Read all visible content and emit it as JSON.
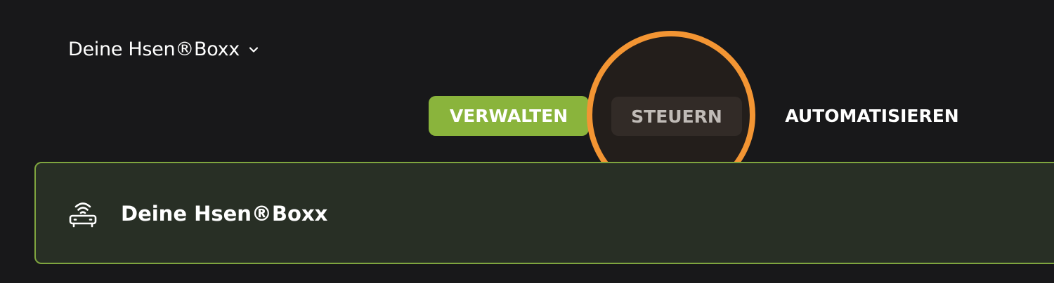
{
  "header": {
    "device_selector_label": "Deine Hsen®Boxx",
    "device_selector_icon": "chevron-down-icon"
  },
  "tabs": [
    {
      "label": "VERWALTEN",
      "active": true
    },
    {
      "label": "STEUERN",
      "active": false,
      "highlighted": true
    },
    {
      "label": "AUTOMATISIEREN",
      "active": false
    }
  ],
  "device_card": {
    "icon": "router-wifi-icon",
    "title": "Deine Hsen®Boxx"
  },
  "colors": {
    "background": "#18181a",
    "accent": "#8ab43c",
    "card_background": "#282f25",
    "card_border": "#7fa53f",
    "highlight_ring": "#f39533"
  }
}
